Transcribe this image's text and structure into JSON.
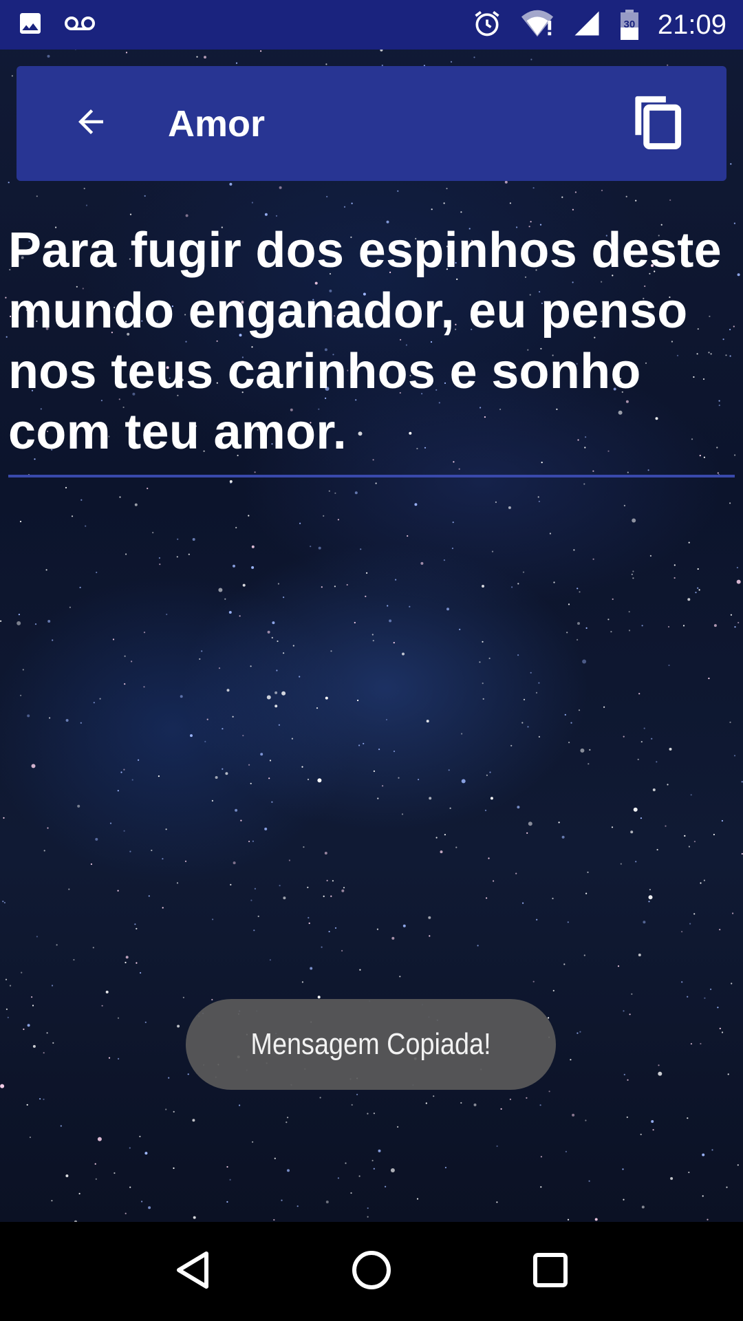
{
  "status_bar": {
    "time": "21:09",
    "icons": [
      "image-icon",
      "voicemail-icon",
      "alarm-icon",
      "wifi-alert-icon",
      "signal-icon",
      "battery-icon"
    ],
    "battery_label": "30",
    "color": "#1a237e"
  },
  "app_bar": {
    "title": "Amor",
    "back_icon": "arrow-back-icon",
    "copy_icon": "content-copy-icon",
    "color": "#283593"
  },
  "message": {
    "text": "Para fugir dos espinhos deste mundo enganador, eu penso nos teus carinhos e sonho com teu amor.",
    "underline_color": "#3949ab"
  },
  "toast": {
    "text": "Mensagem Copiada!"
  },
  "nav_bar": {
    "buttons": [
      "back-triangle-icon",
      "home-circle-icon",
      "recents-square-icon"
    ]
  }
}
